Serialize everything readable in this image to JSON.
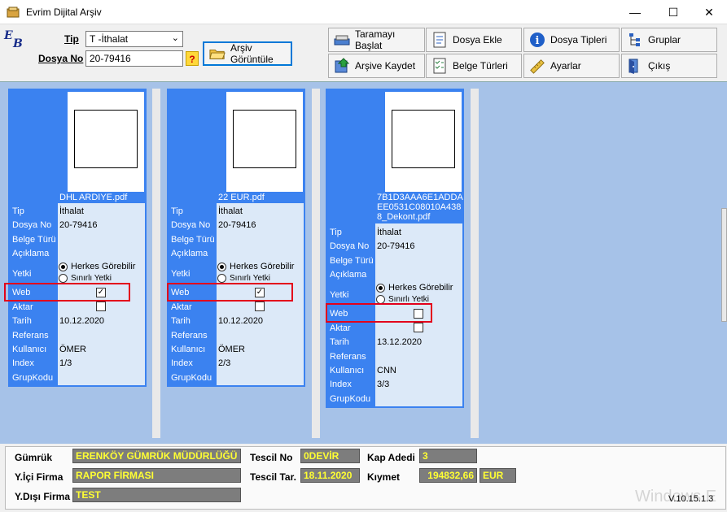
{
  "window": {
    "title": "Evrim Dijital Arşiv"
  },
  "form": {
    "tip_label": "Tip",
    "tip_value": "T -İthalat",
    "dosya_label": "Dosya No",
    "dosya_value": "20-79416",
    "help": "?"
  },
  "toolbar": {
    "goruntule": "Arşiv Görüntüle",
    "tarama": "Taramayı Başlat",
    "dosya_ekle": "Dosya Ekle",
    "dosya_tipleri": "Dosya Tipleri",
    "gruplar": "Gruplar",
    "kaydet": "Arşive Kaydet",
    "belge": "Belge Türleri",
    "ayarlar": "Ayarlar",
    "cikis": "Çıkış"
  },
  "field_labels": {
    "tip": "Tip",
    "dosya": "Dosya No",
    "belge": "Belge Türü",
    "aciklama": "Açıklama",
    "yetki": "Yetki",
    "web": "Web",
    "aktar": "Aktar",
    "tarih": "Tarih",
    "referans": "Referans",
    "kullanici": "Kullanıcı",
    "index": "Index",
    "grup": "GrupKodu"
  },
  "radio_labels": {
    "herkes": "Herkes Görebilir",
    "sinirli": "Sınırlı Yetki"
  },
  "cards": [
    {
      "filename": "DHL ARDIYE.pdf",
      "tip": "İthalat",
      "dosya": "20-79416",
      "yetki": "herkes",
      "web_checked": true,
      "web_mark": "✓",
      "tarih": "10.12.2020",
      "kullanici": "ÖMER",
      "index": "1/3"
    },
    {
      "filename": "22 EUR.pdf",
      "tip": "İthalat",
      "dosya": "20-79416",
      "yetki": "herkes",
      "web_checked": true,
      "web_mark": "✓",
      "tarih": "10.12.2020",
      "kullanici": "ÖMER",
      "index": "2/3"
    },
    {
      "filename_lines": [
        "7B1D3AAA6E1ADDA",
        "EE0531C08010A438",
        "8_Dekont.pdf"
      ],
      "tip": "İthalat",
      "dosya": "20-79416",
      "yetki": "herkes",
      "web_checked": false,
      "web_mark": "",
      "tarih": "13.12.2020",
      "kullanici": "CNN",
      "index": "3/3"
    }
  ],
  "footer": {
    "gumruk_label": "Gümrük",
    "gumruk": "ERENKÖY GÜMRÜK MÜDÜRLÜĞÜ",
    "ici_label": "Y.İçi Firma",
    "ici": "RAPOR FİRMASI",
    "disi_label": "Y.Dışı Firma",
    "disi": "TEST",
    "tescil_no_label": "Tescil No",
    "tescil_no": "0DEVİR",
    "tescil_tar_label": "Tescil Tar.",
    "tescil_tar": "18.11.2020",
    "kap_label": "Kap Adedi",
    "kap": "3",
    "kiymet_label": "Kıymet",
    "kiymet": "194832,66",
    "currency": "EUR"
  },
  "version": "V.10.15.1.3",
  "watermark": "Windows E",
  "colors": {
    "card": "#3b82f0",
    "workspace": "#a6c2e8",
    "highlight": "#e3001b",
    "field_text": "#ffff33"
  }
}
